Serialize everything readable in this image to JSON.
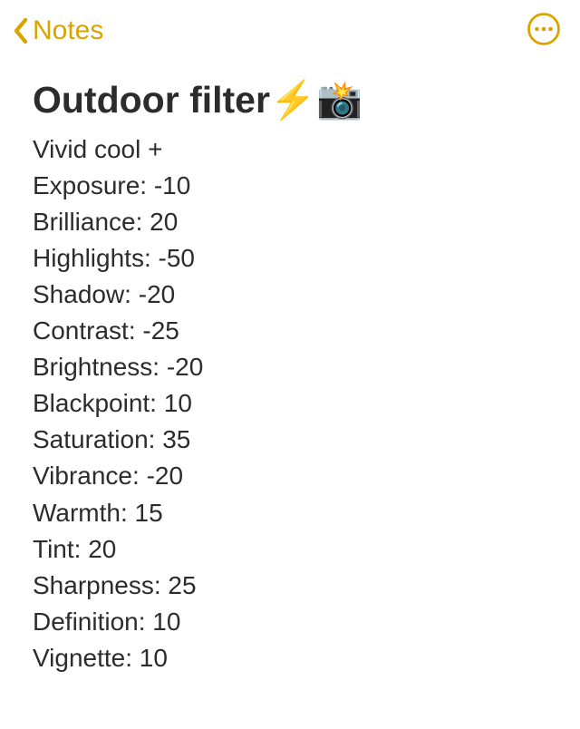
{
  "header": {
    "back_label": "Notes"
  },
  "note": {
    "title": "Outdoor filter⚡️📸",
    "lines": [
      "Vivid cool +",
      "Exposure: -10",
      "Brilliance: 20",
      "Highlights: -50",
      "Shadow: -20",
      "Contrast: -25",
      "Brightness: -20",
      "Blackpoint: 10",
      "Saturation: 35",
      "Vibrance: -20",
      "Warmth: 15",
      "Tint: 20",
      "Sharpness: 25",
      "Definition: 10",
      "Vignette: 10"
    ]
  },
  "colors": {
    "accent": "#d9a400",
    "text": "#2c2c2c"
  }
}
